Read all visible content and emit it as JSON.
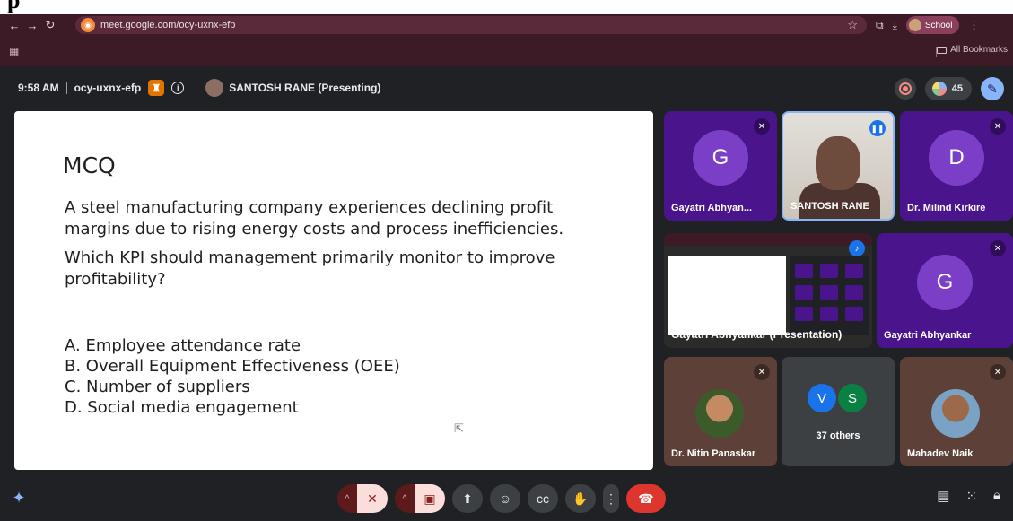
{
  "browser": {
    "url": "meet.google.com/ocy-uxnx-efp",
    "profile_label": "School",
    "bookmarks_label": "All Bookmarks"
  },
  "meeting": {
    "time": "9:58 AM",
    "code": "ocy-uxnx-efp",
    "presenter": "SANTOSH RANE (Presenting)",
    "participant_count": "45"
  },
  "slide": {
    "title": "MCQ",
    "question_1": "A steel manufacturing company experiences declining profit margins due to rising energy costs and process inefficiencies.",
    "question_2": "Which KPI should management primarily monitor to improve profitability?",
    "options": [
      "A. Employee attendance rate",
      "B. Overall Equipment Effectiveness (OEE)",
      "C. Number of suppliers",
      "D. Social media engagement"
    ]
  },
  "tiles": [
    {
      "name": "Gayatri Abhyan...",
      "initial": "G"
    },
    {
      "name": "SANTOSH RANE"
    },
    {
      "name": "Dr. Milind Kirkire",
      "initial": "D"
    },
    {
      "name": "Gayatri Abhyankar (Presentation)"
    },
    {
      "name": "Gayatri Abhyankar",
      "initial": "G"
    },
    {
      "name": "Dr. Nitin Panaskar"
    },
    {
      "name": "37 others",
      "initials": [
        "V",
        "S"
      ]
    },
    {
      "name": "Mahadev Naik"
    }
  ],
  "colors": {
    "chrome": "#3c1b27",
    "stage": "#202124",
    "tile_purple": "#4a148c",
    "leave_red": "#dc362e"
  }
}
